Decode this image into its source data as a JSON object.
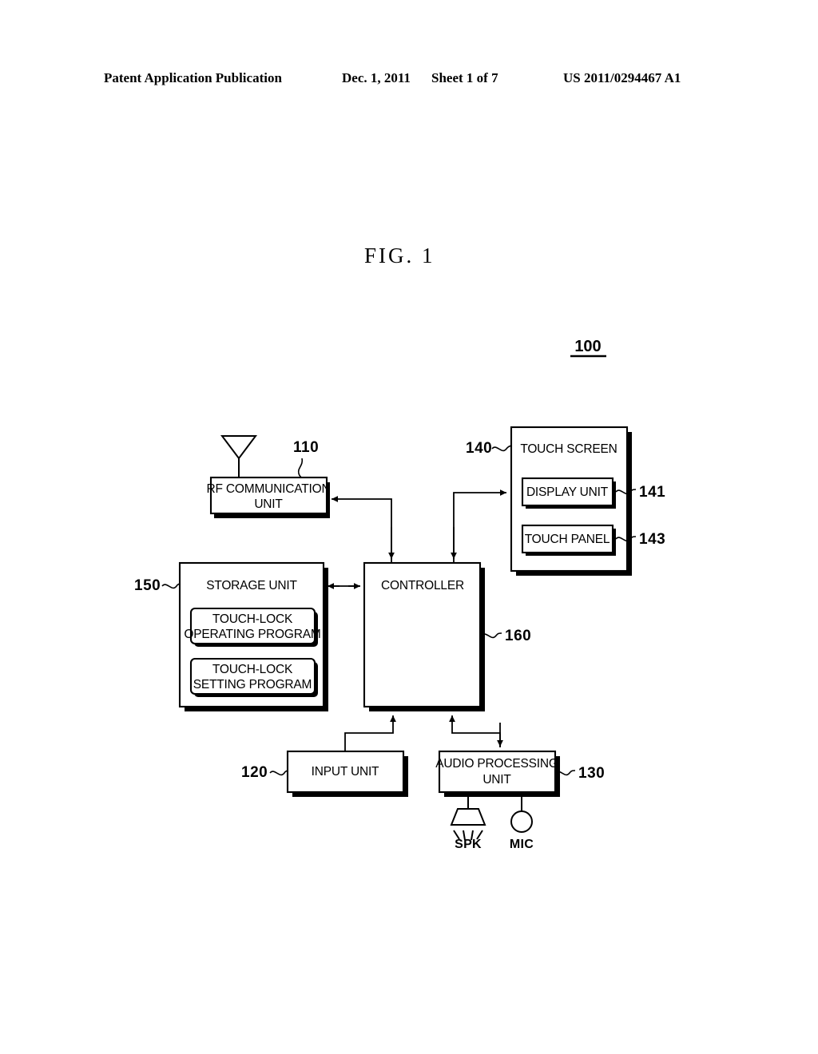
{
  "header": {
    "publication": "Patent Application Publication",
    "date": "Dec. 1, 2011",
    "sheet": "Sheet 1 of 7",
    "patent_number": "US 2011/0294467 A1"
  },
  "figure": {
    "caption": "FIG. 1",
    "system_ref": "100"
  },
  "blocks": {
    "rf_communication": {
      "label_line1": "RF COMMUNICATION",
      "label_line2": "UNIT",
      "ref": "110"
    },
    "touch_screen": {
      "label": "TOUCH SCREEN",
      "ref": "140"
    },
    "display_unit": {
      "label": "DISPLAY UNIT",
      "ref": "141"
    },
    "touch_panel": {
      "label": "TOUCH PANEL",
      "ref": "143"
    },
    "storage_unit": {
      "label": "STORAGE UNIT",
      "ref": "150"
    },
    "touch_lock_operating": {
      "label_line1": "TOUCH-LOCK",
      "label_line2": "OPERATING PROGRAM"
    },
    "touch_lock_setting": {
      "label_line1": "TOUCH-LOCK",
      "label_line2": "SETTING PROGRAM"
    },
    "controller": {
      "label": "CONTROLLER",
      "ref": "160"
    },
    "input_unit": {
      "label": "INPUT UNIT",
      "ref": "120"
    },
    "audio_processing": {
      "label_line1": "AUDIO PROCESSING",
      "label_line2": "UNIT",
      "ref": "130"
    }
  },
  "devices": {
    "speaker": {
      "label": "SPK",
      "icon": "speaker-icon"
    },
    "microphone": {
      "label": "MIC",
      "icon": "microphone-icon"
    },
    "antenna": {
      "icon": "antenna-icon"
    }
  },
  "colors": {
    "ink": "#000000",
    "paper": "#ffffff"
  }
}
